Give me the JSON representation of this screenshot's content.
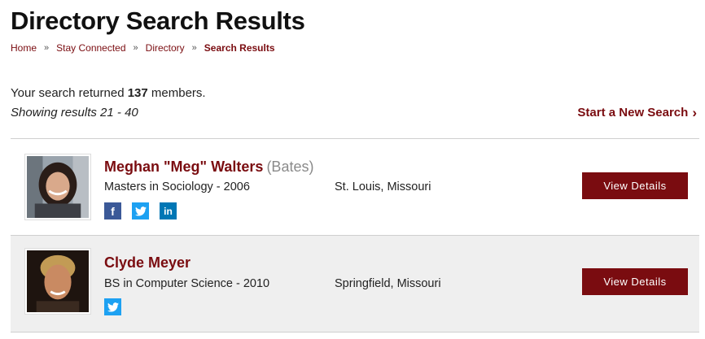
{
  "page": {
    "title": "Directory Search Results"
  },
  "breadcrumb": {
    "items": [
      "Home",
      "Stay Connected",
      "Directory"
    ],
    "separator": "»",
    "current": "Search Results"
  },
  "summary": {
    "prefix": "Your search returned ",
    "count": "137",
    "suffix": " members.",
    "showing": "Showing results 21 - 40"
  },
  "new_search": {
    "label": "Start a New Search",
    "icon": "chevron-right-icon"
  },
  "results": [
    {
      "name": "Meghan \"Meg\" Walters",
      "maiden": "(Bates)",
      "degree": "Masters in Sociology - 2006",
      "location": "St. Louis, Missouri",
      "socials": [
        "facebook",
        "twitter",
        "linkedin"
      ],
      "button": "View Details"
    },
    {
      "name": "Clyde Meyer",
      "degree": "BS in Computer Science - 2010",
      "location": "Springfield, Missouri",
      "socials": [
        "twitter"
      ],
      "button": "View Details"
    }
  ],
  "colors": {
    "accent": "#7a0c10",
    "facebook": "#3b5998",
    "twitter": "#1da1f2",
    "linkedin": "#0077b5",
    "alt_row": "#efefef"
  }
}
